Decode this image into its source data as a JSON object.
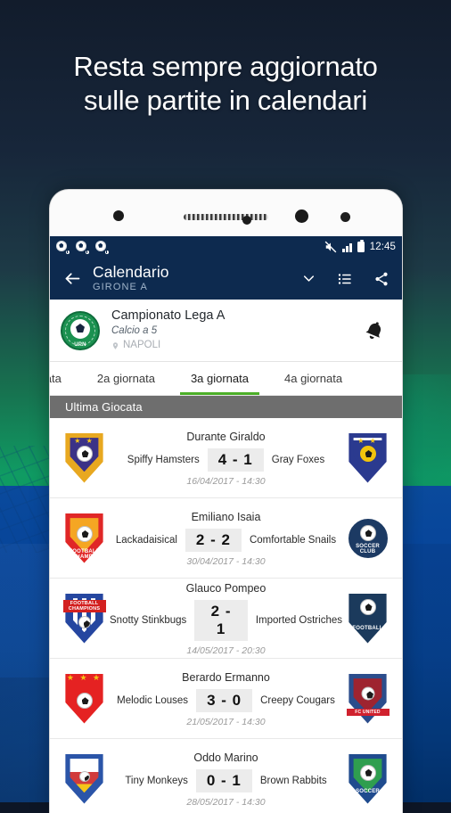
{
  "headline": {
    "line1": "Resta sempre aggiornato",
    "line2": "sulle partite in calendari"
  },
  "phone": {
    "statusbar": {
      "notifications": [
        "soccer-ball-notification",
        "soccer-ball-notification",
        "soccer-ball-notification"
      ],
      "mute_icon": "mute-icon",
      "signal_icon": "signal-icon",
      "battery_icon": "battery-icon",
      "time": "12:45"
    },
    "appbar": {
      "back_icon": "arrow-left-icon",
      "title": "Calendario",
      "subtitle": "GIRONE A",
      "actions": [
        {
          "icon": "chevron-down-icon",
          "name": "expand-button"
        },
        {
          "icon": "list-icon",
          "name": "list-view-button"
        },
        {
          "icon": "share-icon",
          "name": "share-button"
        }
      ]
    },
    "competition": {
      "logo_text": "UPN",
      "name": "Campionato Lega A",
      "type": "Calcio a 5",
      "location": "NAPOLI",
      "location_icon": "location-pin-icon",
      "bell_icon": "bell-icon"
    },
    "tabs": [
      {
        "label": "ornata",
        "active": false
      },
      {
        "label": "2a giornata",
        "active": false
      },
      {
        "label": "3a giornata",
        "active": true
      },
      {
        "label": "4a giornata",
        "active": false
      }
    ],
    "tab_accent": "#4caf28",
    "section_header": "Ultima Giocata",
    "matches": [
      {
        "referee": "Durante Giraldo",
        "home": "Spiffy Hamsters",
        "score": "4 - 1",
        "away": "Gray Foxes",
        "date": "16/04/2017 - 14:30",
        "home_crest": {
          "primary": "#3b3287",
          "secondary": "#e8a820",
          "label": ""
        },
        "away_crest": {
          "primary": "#2b3a8f",
          "secondary": "#f2c40c",
          "label": ""
        }
      },
      {
        "referee": "Emiliano Isaia",
        "home": "Lackadaisical",
        "score": "2 - 2",
        "away": "Comfortable Snails",
        "date": "30/04/2017 - 14:30",
        "home_crest": {
          "primary": "#e02727",
          "secondary": "#f5a623",
          "label": "FOOTBALL CHAMPS"
        },
        "away_crest": {
          "primary": "#1c3a63",
          "secondary": "#ffffff",
          "label": "SOCCER CLUB"
        }
      },
      {
        "referee": "Glauco Pompeo",
        "home": "Snotty Stinkbugs",
        "score": "2 - 1",
        "away": "Imported Ostriches",
        "date": "14/05/2017 - 20:30",
        "home_crest": {
          "primary": "#2546a0",
          "secondary": "#d32020",
          "label": "FOOTBALL CHAMPIONS"
        },
        "away_crest": {
          "primary": "#1b3a5c",
          "secondary": "#ffffff",
          "label": "FOOTBALL"
        }
      },
      {
        "referee": "Berardo Ermanno",
        "home": "Melodic Louses",
        "score": "3 - 0",
        "away": "Creepy Cougars",
        "date": "21/05/2017 - 14:30",
        "home_crest": {
          "primary": "#e52222",
          "secondary": "#f5c518",
          "label": ""
        },
        "away_crest": {
          "primary": "#9e2430",
          "secondary": "#2b4d8c",
          "label": "FC UNITED"
        }
      },
      {
        "referee": "Oddo Marino",
        "home": "Tiny Monkeys",
        "score": "0 - 1",
        "away": "Brown Rabbits",
        "date": "28/05/2017 - 14:30",
        "home_crest": {
          "primary": "#d13b3b",
          "secondary": "#2b55a8",
          "label": ""
        },
        "away_crest": {
          "primary": "#2f9e4f",
          "secondary": "#1f4b8e",
          "label": "SOCCER"
        }
      }
    ]
  },
  "colors": {
    "appbar": "#0d2a4f",
    "accent_green": "#4caf28",
    "section_gray": "#6e6e6e",
    "bg_top": "#131d2e",
    "bg_bottom": "#064291"
  }
}
